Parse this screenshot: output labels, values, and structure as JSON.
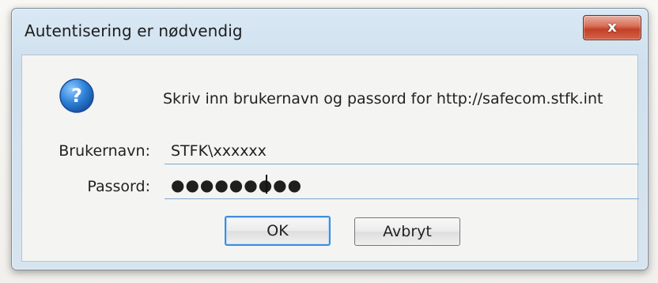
{
  "window": {
    "title": "Autentisering er nødvendig",
    "close_glyph": "x"
  },
  "dialog": {
    "icon": "question-icon",
    "message": "Skriv inn brukernavn og passord for http://safecom.stfk.int",
    "username_label": "Brukernavn:",
    "username_value": "STFK\\xxxxxx",
    "password_label": "Passord:",
    "password_value": "●●●●●●●●●",
    "ok_label": "OK",
    "cancel_label": "Avbryt"
  },
  "colors": {
    "accent": "#3e8ede",
    "close_button": "#c34026",
    "icon_blue": "#1e6fc8"
  }
}
